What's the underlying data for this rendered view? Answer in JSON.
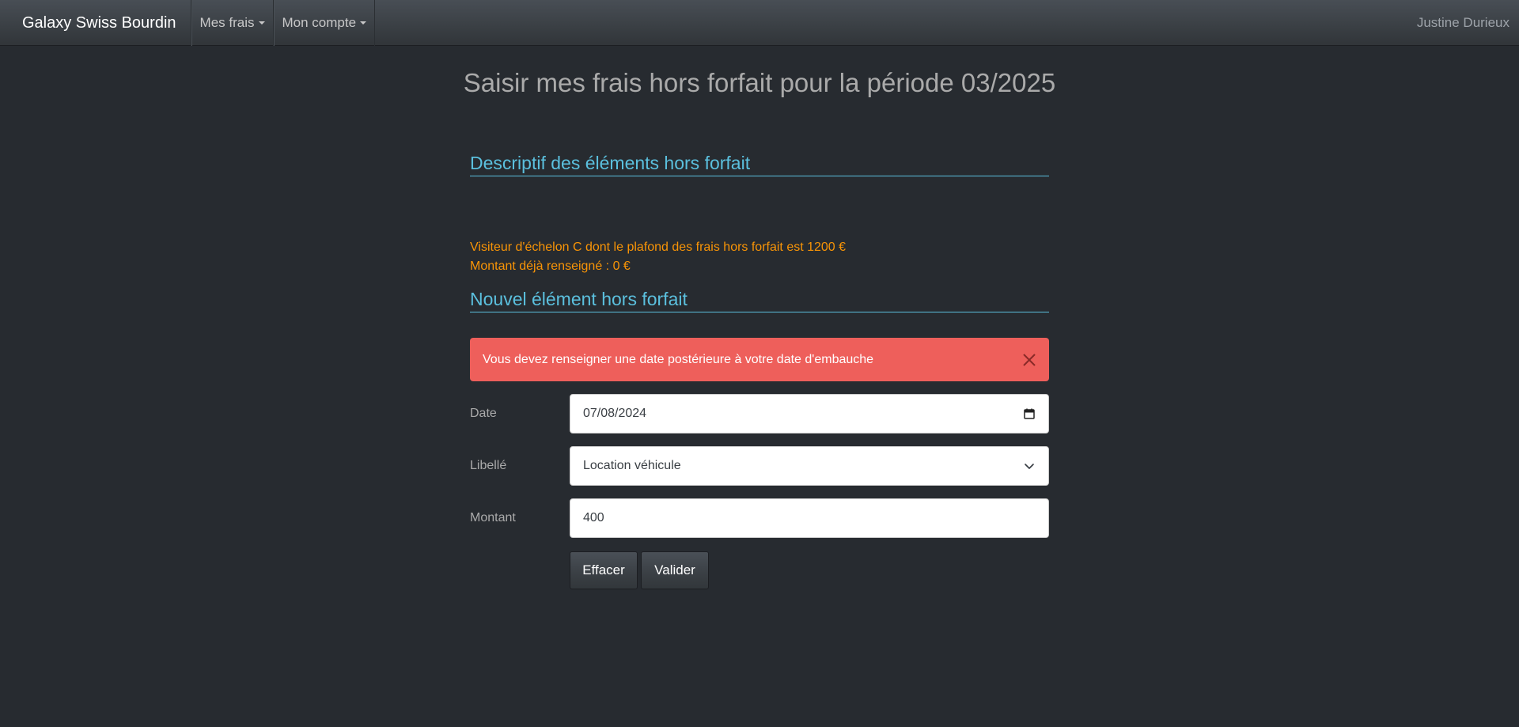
{
  "navbar": {
    "brand": "Galaxy Swiss Bourdin",
    "menus": [
      {
        "label": "Mes frais"
      },
      {
        "label": "Mon compte"
      }
    ],
    "user": "Justine Durieux"
  },
  "main": {
    "title": "Saisir mes frais hors forfait pour la période 03/2025",
    "section_descriptif": "Descriptif des éléments hors forfait",
    "info": {
      "plafond": "Visiteur d'échelon C dont le plafond des frais hors forfait est 1200 €",
      "deja_renseigne": "Montant déjà renseigné : 0 €"
    },
    "section_nouvel": "Nouvel élément hors forfait",
    "alert": {
      "message": "Vous devez renseigner une date postérieure à votre date d'embauche",
      "color": "#ee5f5b"
    },
    "form": {
      "date_label": "Date",
      "date_value": "07/08/2024",
      "libelle_label": "Libellé",
      "libelle_value": "Location véhicule",
      "montant_label": "Montant",
      "montant_value": "400",
      "effacer_label": "Effacer",
      "valider_label": "Valider"
    }
  },
  "colors": {
    "background": "#272b30",
    "accent": "#5bc0de",
    "warning_text": "#f89406"
  },
  "icons": [
    "caret-down-icon",
    "close-icon",
    "calendar-icon",
    "chevron-down-icon"
  ]
}
